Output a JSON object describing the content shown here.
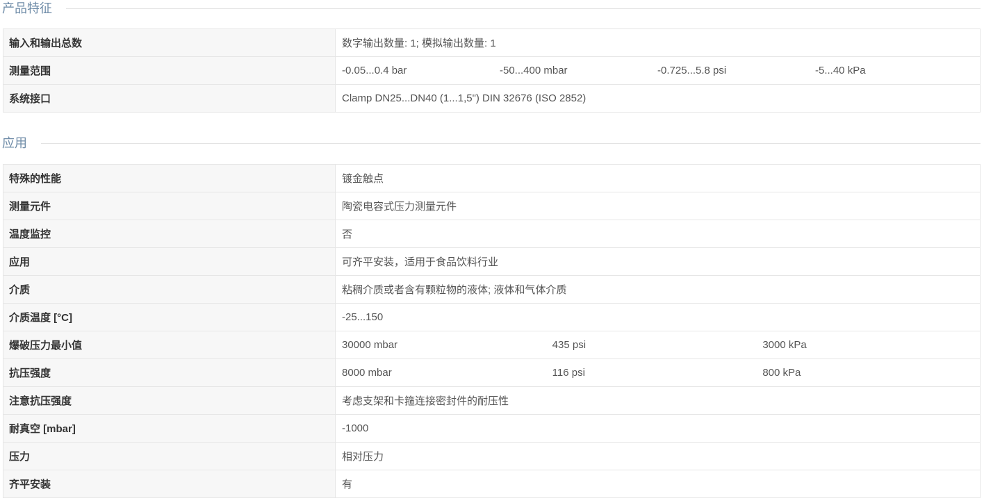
{
  "sections": [
    {
      "title": "产品特征",
      "rows": [
        {
          "label": "输入和输出总数",
          "values": [
            "数字输出数量: 1; 模拟输出数量: 1"
          ]
        },
        {
          "label": "测量范围",
          "values": [
            "-0.05...0.4 bar",
            "-50...400 mbar",
            "-0.725...5.8 psi",
            "-5...40 kPa"
          ]
        },
        {
          "label": "系统接口",
          "values": [
            "Clamp DN25...DN40 (1...1,5\") DIN 32676 (ISO 2852)"
          ]
        }
      ]
    },
    {
      "title": "应用",
      "rows": [
        {
          "label": "特殊的性能",
          "values": [
            "镀金触点"
          ]
        },
        {
          "label": "测量元件",
          "values": [
            "陶瓷电容式压力测量元件"
          ]
        },
        {
          "label": "温度监控",
          "values": [
            "否"
          ]
        },
        {
          "label": "应用",
          "values": [
            "可齐平安装，适用于食品饮料行业"
          ]
        },
        {
          "label": "介质",
          "values": [
            "粘稠介质或者含有颗粒物的液体; 液体和气体介质"
          ]
        },
        {
          "label": "介质温度 [°C]",
          "values": [
            "-25...150"
          ]
        },
        {
          "label": "爆破压力最小值",
          "values": [
            "30000 mbar",
            "435 psi",
            "3000 kPa"
          ]
        },
        {
          "label": "抗压强度",
          "values": [
            "8000 mbar",
            "116 psi",
            "800 kPa"
          ]
        },
        {
          "label": "注意抗压强度",
          "values": [
            "考虑支架和卡箍连接密封件的耐压性"
          ]
        },
        {
          "label": "耐真空 [mbar]",
          "values": [
            "-1000"
          ]
        },
        {
          "label": "压力",
          "values": [
            "相对压力"
          ]
        },
        {
          "label": "齐平安装",
          "values": [
            "有"
          ]
        }
      ]
    }
  ],
  "colors": {
    "section_title": "#6f8ca8",
    "divider": "#e3e3e3",
    "border": "#e6e6e6",
    "label_bg": "#f7f7f7",
    "label_text": "#333333",
    "value_text": "#555555"
  }
}
